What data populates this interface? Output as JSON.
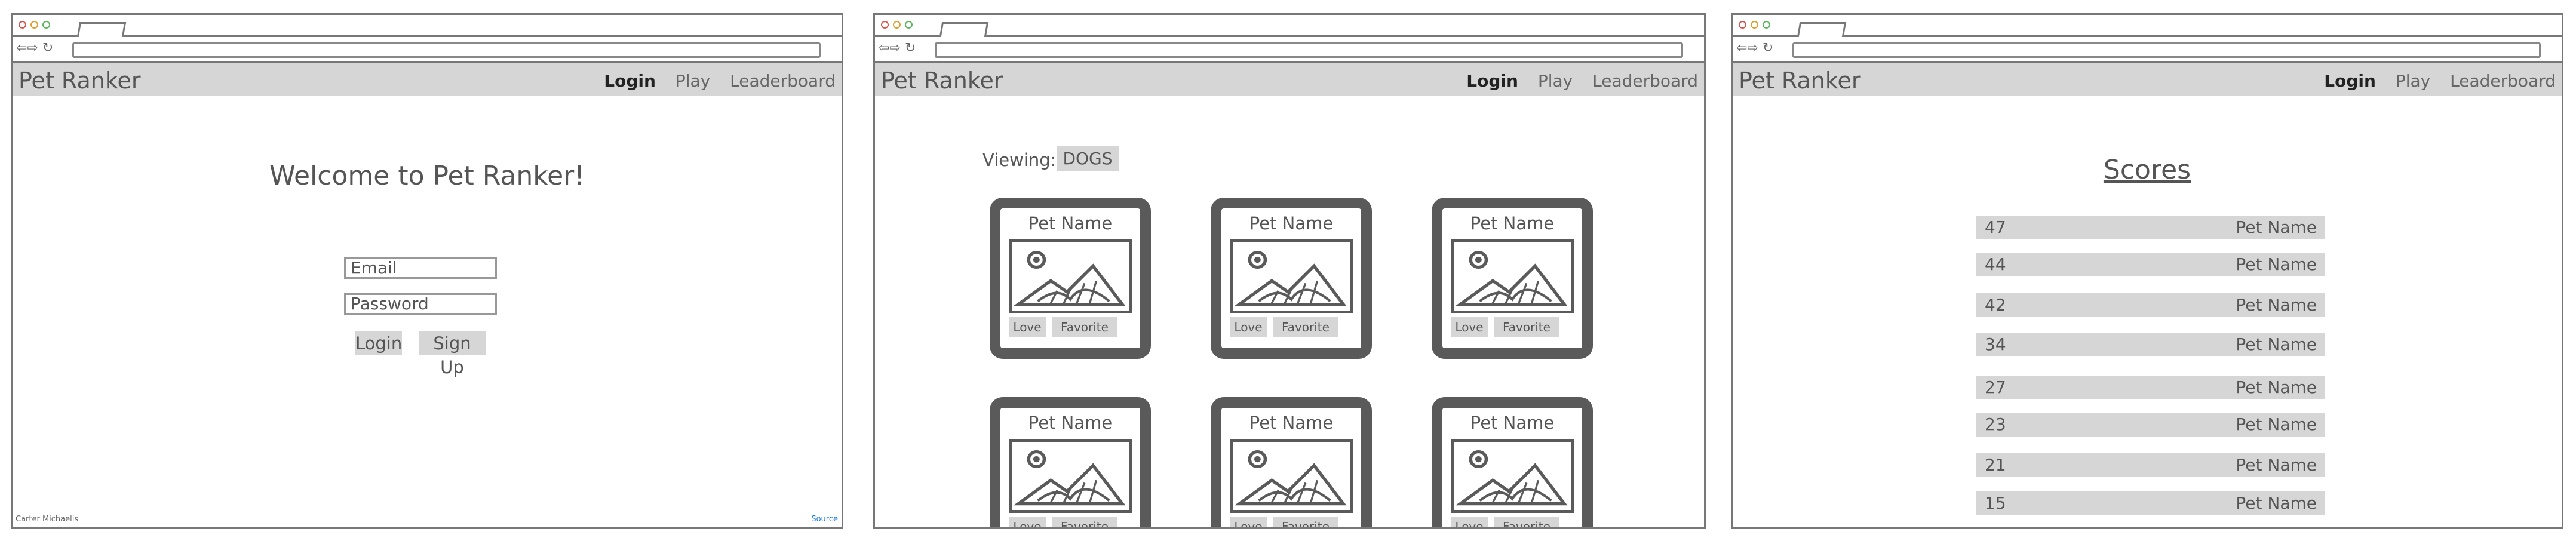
{
  "app": {
    "brand": "Pet Ranker",
    "nav": {
      "login": "Login",
      "play": "Play",
      "leaderboard": "Leaderboard"
    }
  },
  "login_screen": {
    "welcome": "Welcome to Pet Ranker!",
    "email_placeholder": "Email",
    "password_placeholder": "Password",
    "login_button": "Login",
    "signup_button": "Sign Up",
    "footer_author": "Carter Michaelis",
    "footer_source": "Source"
  },
  "play_screen": {
    "viewing_label": "Viewing:",
    "viewing_value": "DOGS",
    "cards": [
      {
        "name": "Pet Name",
        "love": "Love",
        "favorite": "Favorite"
      },
      {
        "name": "Pet Name",
        "love": "Love",
        "favorite": "Favorite"
      },
      {
        "name": "Pet Name",
        "love": "Love",
        "favorite": "Favorite"
      },
      {
        "name": "Pet Name",
        "love": "Love",
        "favorite": "Favorite"
      },
      {
        "name": "Pet Name",
        "love": "Love",
        "favorite": "Favorite"
      },
      {
        "name": "Pet Name",
        "love": "Love",
        "favorite": "Favorite"
      }
    ]
  },
  "leaderboard_screen": {
    "title": "Scores",
    "rows": [
      {
        "score": "47",
        "name": "Pet Name"
      },
      {
        "score": "44",
        "name": "Pet Name"
      },
      {
        "score": "42",
        "name": "Pet Name"
      },
      {
        "score": "34",
        "name": "Pet Name"
      },
      {
        "score": "27",
        "name": "Pet Name"
      },
      {
        "score": "23",
        "name": "Pet Name"
      },
      {
        "score": "21",
        "name": "Pet Name"
      },
      {
        "score": "15",
        "name": "Pet Name"
      }
    ]
  },
  "colors": {
    "navbar": "#d6d6d6",
    "card": "#5a5a5a",
    "link": "#1a7be0"
  }
}
